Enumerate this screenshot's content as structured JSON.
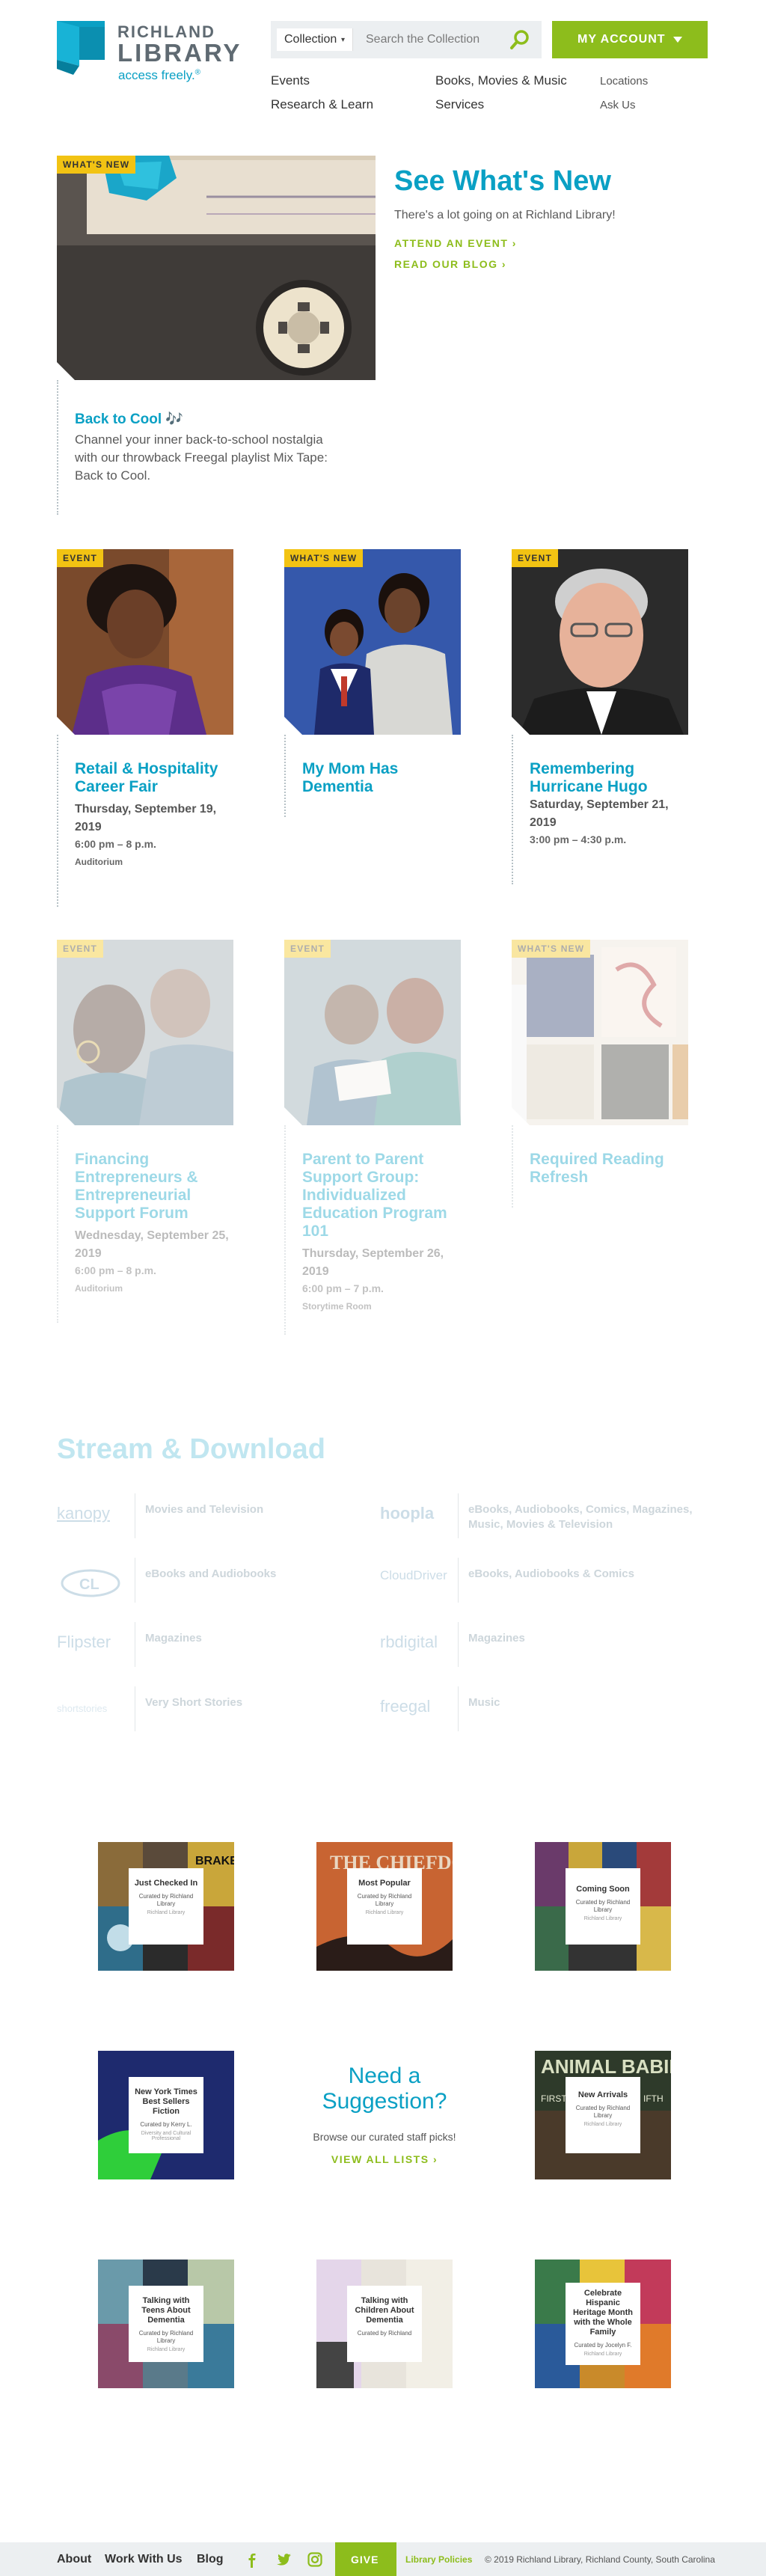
{
  "header": {
    "logo_line1": "RICHLAND",
    "logo_line2": "LIBRARY",
    "tagline": "access freely.",
    "tagline_mark": "®",
    "search_scope": "Collection",
    "search_placeholder": "Search the Collection",
    "account_label": "MY ACCOUNT"
  },
  "nav": {
    "primary": [
      "Events",
      "Books, Movies & Music",
      "Research & Learn",
      "Services"
    ],
    "secondary": [
      "Locations",
      "Ask Us"
    ]
  },
  "hero": {
    "tag": "WHAT'S NEW",
    "heading": "See What's New",
    "subheading": "There's a lot going on at Richland Library!",
    "cta1": "ATTEND AN EVENT",
    "cta2": "READ OUR BLOG",
    "cta_arrow": "›",
    "feature_title": "Back to Cool",
    "feature_note": "🎶",
    "feature_desc": "Channel your inner back-to-school nostalgia with our throwback Freegal playlist Mix Tape: Back to Cool."
  },
  "cards_row1": [
    {
      "tag": "EVENT",
      "title": "Retail & Hospitality Career Fair",
      "date": "Thursday, September 19, 2019",
      "time": "6:00 pm – 8 p.m.",
      "location": "Auditorium"
    },
    {
      "tag": "WHAT'S NEW",
      "title": "My Mom Has Dementia",
      "date": "",
      "time": "",
      "location": ""
    },
    {
      "tag": "EVENT",
      "title": "Remembering Hurricane Hugo",
      "date": "Saturday, September 21, 2019",
      "time": "3:00 pm – 4:30 p.m.",
      "location": ""
    }
  ],
  "cards_row2": [
    {
      "tag": "EVENT",
      "title": "Financing Entrepreneurs & Entrepreneurial Support Forum",
      "date": "Wednesday, September 25, 2019",
      "time": "6:00 pm – 8 p.m.",
      "location": "Auditorium"
    },
    {
      "tag": "EVENT",
      "title": "Parent to Parent Support Group: Individualized Education Program 101",
      "date": "Thursday, September 26, 2019",
      "time": "6:00 pm – 7 p.m.",
      "location": "Storytime Room"
    },
    {
      "tag": "WHAT'S NEW",
      "title": "Required Reading Refresh",
      "date": "",
      "time": "",
      "location": ""
    }
  ],
  "stream": {
    "heading": "Stream & Download",
    "services": [
      {
        "logo": "kanopy",
        "desc": "Movies and Television"
      },
      {
        "logo": "hoopla",
        "desc": "eBooks, Audiobooks, Comics, Magazines, Music, Movies & Television"
      },
      {
        "logo": "CL",
        "desc": "eBooks and Audiobooks"
      },
      {
        "logo": "CloudDriver",
        "desc": "eBooks, Audiobooks & Comics"
      },
      {
        "logo": "Flipster",
        "desc": "Magazines"
      },
      {
        "logo": "rbdigital",
        "desc": "Magazines"
      },
      {
        "logo": "shortstories",
        "desc": "Very Short Stories"
      },
      {
        "logo": "freegal",
        "desc": "Music"
      }
    ]
  },
  "suggestion": {
    "heading": "Need a Suggestion?",
    "subheading": "Browse our curated staff picks!",
    "cta": "VIEW ALL LISTS",
    "cta_arrow": "›"
  },
  "lists": [
    {
      "title": "Just Checked In",
      "curator": "Curated by Richland Library",
      "author": "Richland Library"
    },
    {
      "title": "Most Popular",
      "curator": "Curated by Richland Library",
      "author": "Richland Library"
    },
    {
      "title": "Coming Soon",
      "curator": "Curated by Richland Library",
      "author": "Richland Library"
    },
    {
      "title": "New York Times Best Sellers Fiction",
      "curator": "Curated by Kerry L.",
      "author": "Diversity and Cultural Professional"
    },
    {
      "title": "New Arrivals",
      "curator": "Curated by Richland Library",
      "author": "Richland Library"
    },
    {
      "title": "Talking with Teens About Dementia",
      "curator": "Curated by Richland Library",
      "author": "Richland Library"
    },
    {
      "title": "Talking with Children About Dementia",
      "curator": "Curated by Richland",
      "author": ""
    },
    {
      "title": "Celebrate Hispanic Heritage Month with the Whole Family",
      "curator": "Curated by Jocelyn F.",
      "author": "Richland Library"
    }
  ],
  "list_cover_text": [
    "BRAKE",
    "THE CHIEFDOMS",
    "ANIMAL BABIES",
    "FIRST",
    "IFTH"
  ],
  "footer": {
    "links": [
      "About",
      "Work With Us",
      "Blog"
    ],
    "give": "GIVE",
    "policies": "Library Policies",
    "copyright": "© 2019 Richland Library, Richland County, South Carolina"
  },
  "colors": {
    "teal": "#0aa0c4",
    "green": "#8dbd1c",
    "yellow": "#f2c313"
  }
}
